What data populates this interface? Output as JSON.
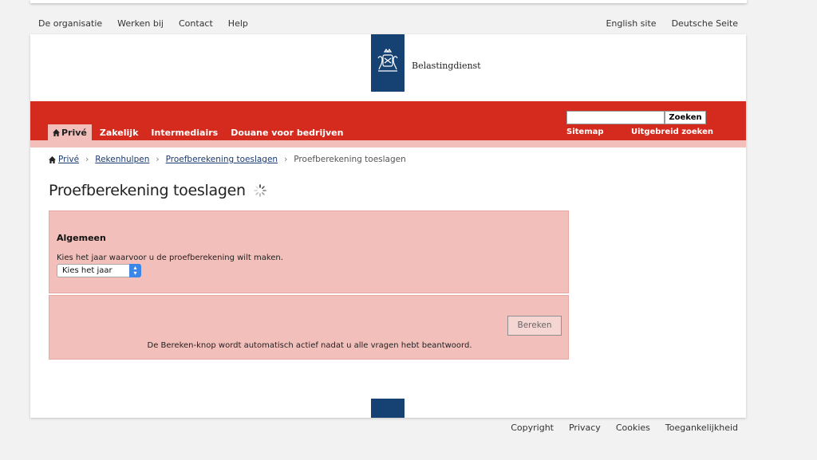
{
  "utility_nav": {
    "left": [
      "De organisatie",
      "Werken bij",
      "Contact",
      "Help"
    ],
    "right": [
      "English site",
      "Deutsche Seite"
    ]
  },
  "header": {
    "logo_text": "Belastingdienst"
  },
  "main_nav": {
    "tabs": [
      "Privé",
      "Zakelijk",
      "Intermediairs",
      "Douane voor bedrijven"
    ],
    "active_tab": "Privé"
  },
  "search": {
    "value": "",
    "button_label": "Zoeken",
    "sitemap": "Sitemap",
    "advanced": "Uitgebreid zoeken"
  },
  "breadcrumb": {
    "items": [
      "Privé",
      "Rekenhulpen",
      "Proefberekening toeslagen",
      "Proefberekening toeslagen"
    ]
  },
  "page": {
    "title": "Proefberekening toeslagen"
  },
  "form": {
    "section_title": "Algemeen",
    "question": "Kies het jaar waarvoor u de proefberekening wilt maken.",
    "select_value": "Kies het jaar",
    "calculate_button": "Bereken",
    "note": "De Bereken-knop wordt automatisch actief nadat u alle vragen hebt beantwoord."
  },
  "footer": {
    "links": [
      "Copyright",
      "Privacy",
      "Cookies",
      "Toegankelijkheid"
    ]
  },
  "colors": {
    "brand_red": "#d52b1e",
    "brand_blue": "#154273",
    "panel_pink": "#f3bfbb"
  },
  "icons": [
    "house-icon",
    "chevron-right-icon",
    "loading-spinner-icon",
    "select-arrows-icon",
    "coat-of-arms-icon"
  ]
}
